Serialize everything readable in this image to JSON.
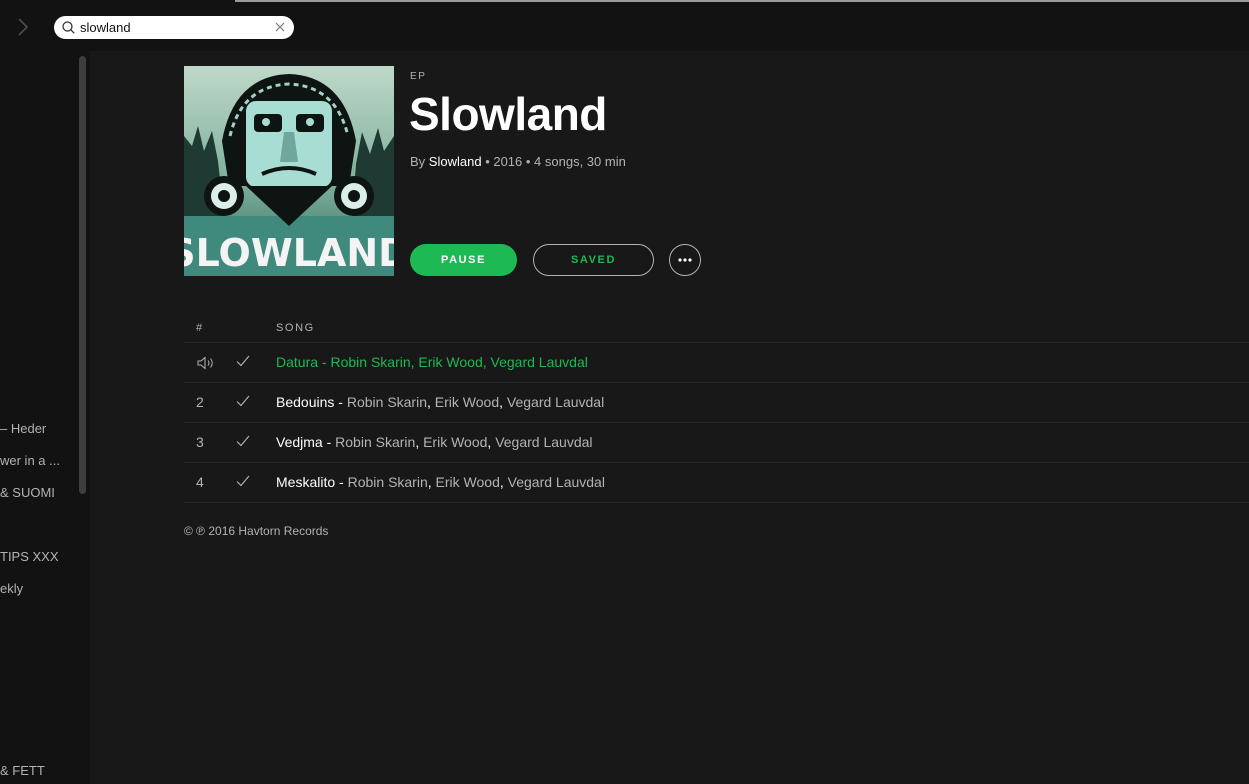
{
  "search": {
    "value": "slowland"
  },
  "sidebar": {
    "playlists": [
      "– Heder",
      "wer in a ...",
      "& SUOMI",
      "TIPS XXX",
      "ekly",
      "& FETT"
    ]
  },
  "album": {
    "type_label": "EP",
    "title": "Slowland",
    "by_prefix": "By",
    "artist": "Slowland",
    "details": "• 2016 • 4 songs, 30 min",
    "cover_text": "SLOWLAND"
  },
  "actions": {
    "pause_label": "PAUSE",
    "saved_label": "SAVED"
  },
  "tracklist": {
    "col_num": "#",
    "col_song": "SONG",
    "tracks": [
      {
        "num": "",
        "title": "Datura",
        "artists": [
          "Robin Skarin",
          "Erik Wood",
          "Vegard Lauvdal"
        ],
        "playing": true
      },
      {
        "num": "2",
        "title": "Bedouins",
        "artists": [
          "Robin Skarin",
          "Erik Wood",
          "Vegard Lauvdal"
        ],
        "playing": false
      },
      {
        "num": "3",
        "title": "Vedjma",
        "artists": [
          "Robin Skarin",
          "Erik Wood",
          "Vegard Lauvdal"
        ],
        "playing": false
      },
      {
        "num": "4",
        "title": "Meskalito",
        "artists": [
          "Robin Skarin",
          "Erik Wood",
          "Vegard Lauvdal"
        ],
        "playing": false
      }
    ]
  },
  "copyright": "© ℗ 2016 Havtorn Records",
  "colors": {
    "accent": "#1db954",
    "background": "#181818",
    "sidebar": "#121212",
    "muted_text": "#b3b3b3"
  },
  "icons": [
    "chevron-right-icon",
    "search-icon",
    "clear-icon",
    "speaker-icon",
    "check-icon",
    "more-icon"
  ]
}
